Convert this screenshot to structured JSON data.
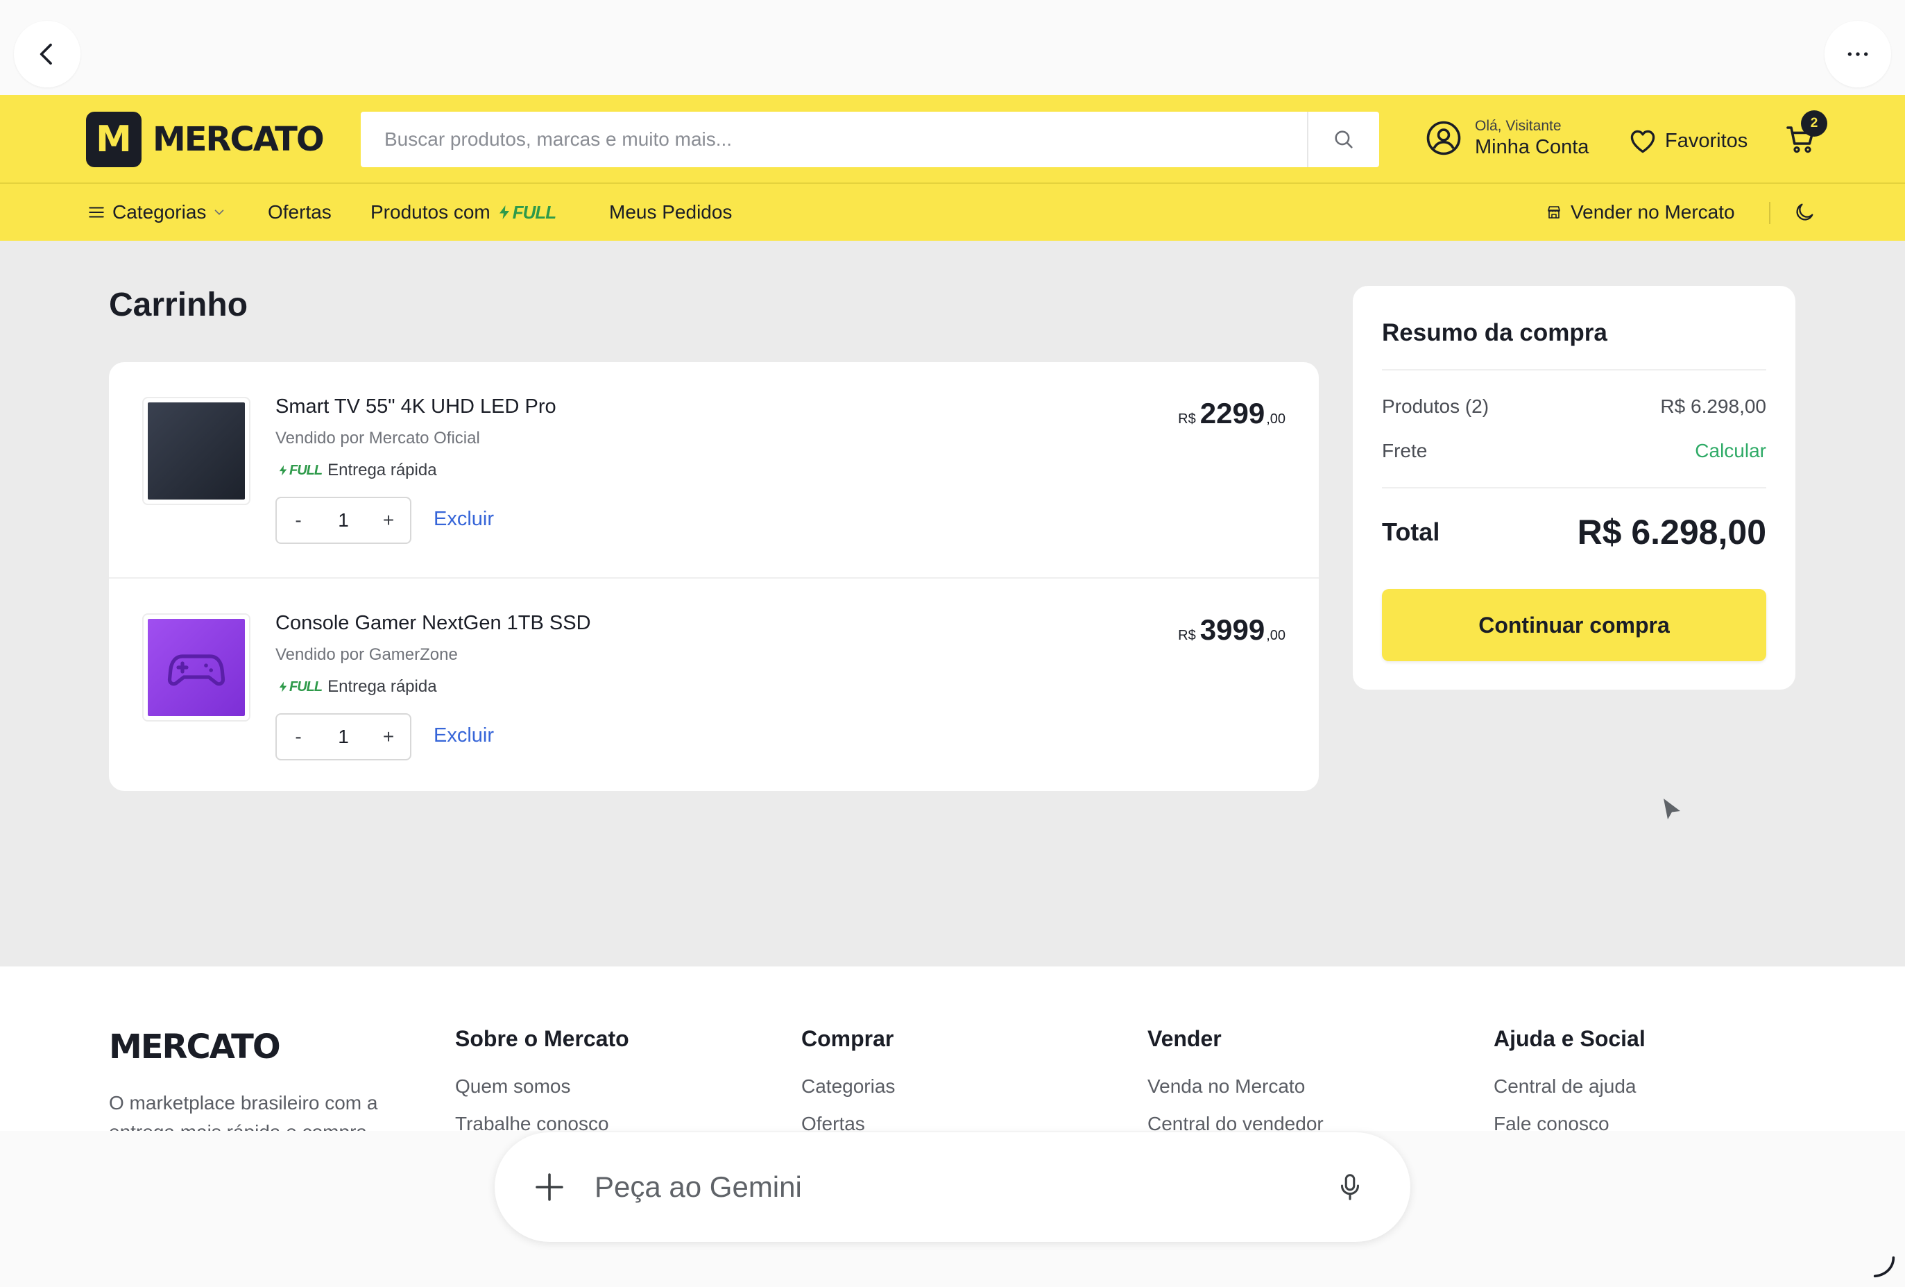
{
  "header": {
    "logo_letter": "M",
    "logo_text": "MERCATO",
    "search_placeholder": "Buscar produtos, marcas e muito mais...",
    "account_greeting": "Olá, Visitante",
    "account_label": "Minha Conta",
    "favorites_label": "Favoritos",
    "cart_count": "2",
    "brand_color": "#fae64b"
  },
  "subnav": {
    "categories_label": "Categorias",
    "offers_label": "Ofertas",
    "full_products_label": "Produtos com",
    "full_tag": "FULL",
    "orders_label": "Meus Pedidos",
    "sell_label": "Vender no Mercato"
  },
  "page": {
    "title": "Carrinho"
  },
  "cart": {
    "items": [
      {
        "name": "Smart TV 55\" 4K UHD LED Pro",
        "seller": "Vendido por Mercato Oficial",
        "full_tag": "FULL",
        "delivery": "Entrega rápida",
        "quantity": "1",
        "remove_label": "Excluir",
        "currency": "R$",
        "price_int": "2299",
        "price_cents": ",00",
        "icon": "tv-icon"
      },
      {
        "name": "Console Gamer NextGen 1TB SSD",
        "seller": "Vendido por GamerZone",
        "full_tag": "FULL",
        "delivery": "Entrega rápida",
        "quantity": "1",
        "remove_label": "Excluir",
        "currency": "R$",
        "price_int": "3999",
        "price_cents": ",00",
        "icon": "gamepad-icon"
      }
    ],
    "decrement_label": "-",
    "increment_label": "+"
  },
  "summary": {
    "title": "Resumo da compra",
    "products_label": "Produtos (2)",
    "products_value": "R$ 6.298,00",
    "shipping_label": "Frete",
    "shipping_action": "Calcular",
    "total_label": "Total",
    "total_value": "R$ 6.298,00",
    "continue_label": "Continuar compra"
  },
  "footer": {
    "logo_text": "MERCATO",
    "description": "O marketplace brasileiro com a entrega mais rápida e compra",
    "columns": [
      {
        "title": "Sobre o Mercato",
        "links": [
          "Quem somos",
          "Trabalhe conosco"
        ]
      },
      {
        "title": "Comprar",
        "links": [
          "Categorias",
          "Ofertas"
        ]
      },
      {
        "title": "Vender",
        "links": [
          "Venda no Mercato",
          "Central do vendedor"
        ]
      },
      {
        "title": "Ajuda e Social",
        "links": [
          "Central de ajuda",
          "Fale conosco"
        ]
      }
    ]
  },
  "gemini": {
    "placeholder": "Peça ao Gemini"
  }
}
